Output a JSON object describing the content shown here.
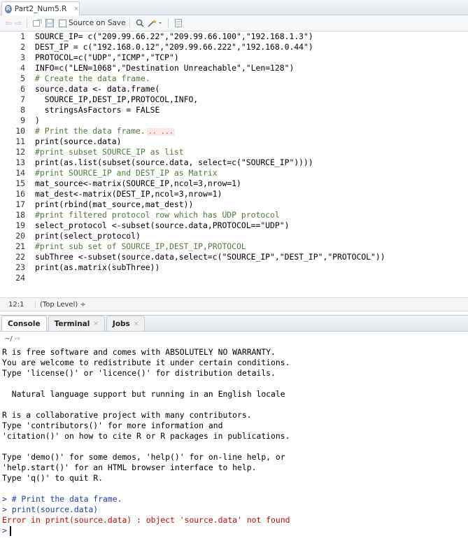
{
  "editor_tab": {
    "icon": "R",
    "filename": "Part2_Num5.R",
    "close": "×"
  },
  "toolbar": {
    "source_on_save": "Source on Save"
  },
  "code_lines": [
    {
      "num": "1",
      "text": "SOURCE_IP= c(\"209.99.66.22\",\"209.99.66.100\",\"192.168.1.3\")",
      "type": "code"
    },
    {
      "num": "2",
      "text": "DEST_IP = c(\"192.168.0.12\",\"209.99.66.222\",\"192.168.0.44\")",
      "type": "code"
    },
    {
      "num": "3",
      "text": "PROTOCOL=c(\"UDP\",\"ICMP\",\"TCP\")",
      "type": "code"
    },
    {
      "num": "4",
      "text": "INFO=c(\"LEN=1068\",\"Destination Unreachable\",\"Len=128\")",
      "type": "code"
    },
    {
      "num": "5",
      "text": "# Create the data frame.",
      "type": "comment"
    },
    {
      "num": "6",
      "text": "source.data <- data.frame(",
      "type": "code"
    },
    {
      "num": "7",
      "text": "  SOURCE_IP,DEST_IP,PROTOCOL,INFO,",
      "type": "code"
    },
    {
      "num": "8",
      "text": "  stringsAsFactors = FALSE",
      "type": "code"
    },
    {
      "num": "9",
      "text": ")",
      "type": "code"
    },
    {
      "num": "10",
      "text": "# Print the data frame.",
      "type": "comment",
      "fold": ".. ..."
    },
    {
      "num": "11",
      "text": "print(source.data)",
      "type": "code"
    },
    {
      "num": "12",
      "text": "#print subset SOURCE_IP as list",
      "type": "comment"
    },
    {
      "num": "13",
      "text": "print(as.list(subset(source.data, select=c(\"SOURCE_IP\"))))",
      "type": "code"
    },
    {
      "num": "14",
      "text": "#print SOURCE_IP and DEST_IP as Matrix",
      "type": "comment"
    },
    {
      "num": "15",
      "text": "mat_source<-matrix(SOURCE_IP,ncol=3,nrow=1)",
      "type": "code"
    },
    {
      "num": "16",
      "text": "mat_dest<-matrix(DEST_IP,ncol=3,nrow=1)",
      "type": "code"
    },
    {
      "num": "17",
      "text": "print(rbind(mat_source,mat_dest))",
      "type": "code"
    },
    {
      "num": "18",
      "text": "#print filtered protocol row which has UDP protocol",
      "type": "comment"
    },
    {
      "num": "19",
      "text": "select_protocol <-subset(source.data,PROTOCOL==\"UDP\")",
      "type": "code"
    },
    {
      "num": "20",
      "text": "print(select_protocol)",
      "type": "code"
    },
    {
      "num": "21",
      "text": "#print sub set of SOURCE_IP,DEST_IP,PROTOCOL",
      "type": "comment"
    },
    {
      "num": "22",
      "text": "subThree <-subset(source.data,select=c(\"SOURCE_IP\",\"DEST_IP\",\"PROTOCOL\"))",
      "type": "code"
    },
    {
      "num": "23",
      "text": "print(as.matrix(subThree))",
      "type": "code"
    },
    {
      "num": "24",
      "text": "",
      "type": "code"
    }
  ],
  "status": {
    "position": "12:1",
    "scope": "(Top Level) ÷"
  },
  "console_tabs": [
    {
      "label": "Console",
      "close": ""
    },
    {
      "label": "Terminal",
      "close": "×"
    },
    {
      "label": "Jobs",
      "close": "×"
    }
  ],
  "console_path": "~/",
  "console_lines": [
    {
      "text": "R is free software and comes with ABSOLUTELY NO WARRANTY.",
      "type": "out"
    },
    {
      "text": "You are welcome to redistribute it under certain conditions.",
      "type": "out"
    },
    {
      "text": "Type 'license()' or 'licence()' for distribution details.",
      "type": "out"
    },
    {
      "text": "",
      "type": "out"
    },
    {
      "text": "  Natural language support but running in an English locale",
      "type": "out"
    },
    {
      "text": "",
      "type": "out"
    },
    {
      "text": "R is a collaborative project with many contributors.",
      "type": "out"
    },
    {
      "text": "Type 'contributors()' for more information and",
      "type": "out"
    },
    {
      "text": "'citation()' on how to cite R or R packages in publications.",
      "type": "out"
    },
    {
      "text": "",
      "type": "out"
    },
    {
      "text": "Type 'demo()' for some demos, 'help()' for on-line help, or",
      "type": "out"
    },
    {
      "text": "'help.start()' for an HTML browser interface to help.",
      "type": "out"
    },
    {
      "text": "Type 'q()' to quit R.",
      "type": "out"
    },
    {
      "text": "",
      "type": "out"
    },
    {
      "text": "> # Print the data frame.",
      "type": "cmd"
    },
    {
      "text": "> print(source.data)",
      "type": "cmd"
    },
    {
      "text": "Error in print(source.data) : object 'source.data' not found",
      "type": "err"
    }
  ],
  "prompt": ">"
}
